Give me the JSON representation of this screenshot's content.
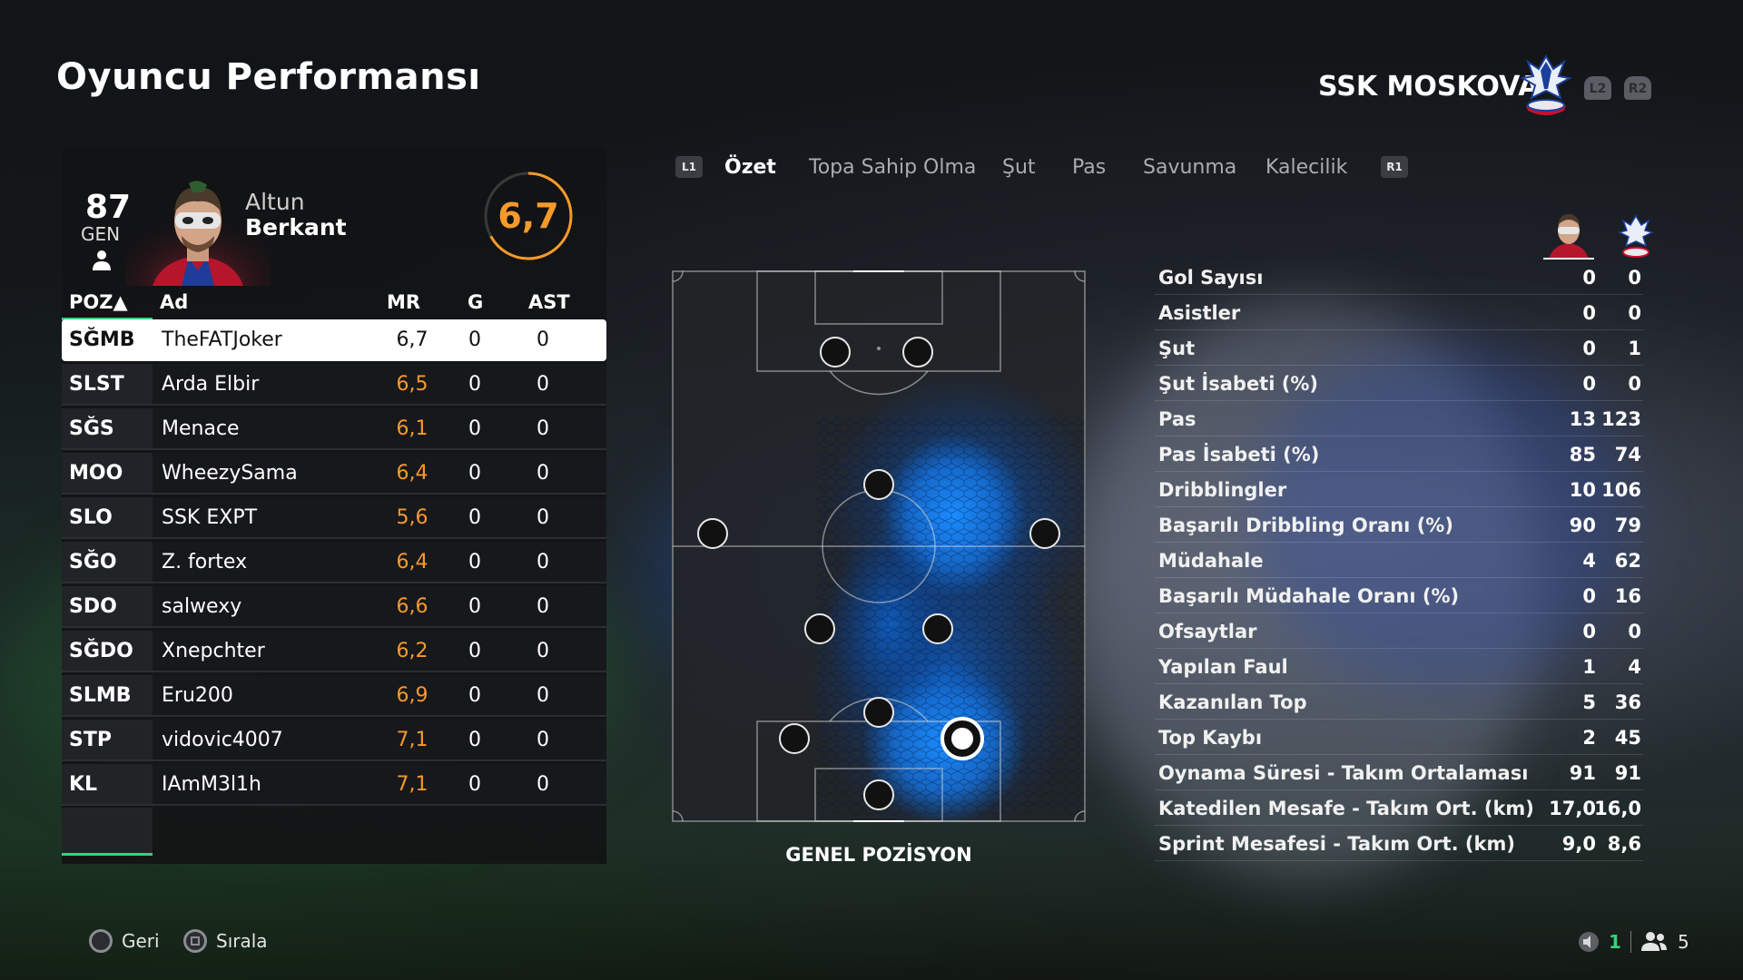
{
  "header": {
    "title": "Oyuncu Performansı",
    "team_name": "SSK MOSKOVA",
    "trigger_left": "L2",
    "trigger_right": "R2"
  },
  "player": {
    "gen_value": "87",
    "gen_label": "GEN",
    "first_name": "Altun",
    "last_name": "Berkant",
    "rating": "6,7"
  },
  "table": {
    "headers": {
      "poz": "POZ▲",
      "ad": "Ad",
      "mr": "MR",
      "g": "G",
      "ast": "AST"
    },
    "rows": [
      {
        "pos": "SĞMB",
        "name": "TheFATJoker",
        "mr": "6,7",
        "g": "0",
        "ast": "0"
      },
      {
        "pos": "SLST",
        "name": "Arda Elbir",
        "mr": "6,5",
        "g": "0",
        "ast": "0"
      },
      {
        "pos": "SĞS",
        "name": "Menace",
        "mr": "6,1",
        "g": "0",
        "ast": "0"
      },
      {
        "pos": "MOO",
        "name": "WheezySama",
        "mr": "6,4",
        "g": "0",
        "ast": "0"
      },
      {
        "pos": "SLO",
        "name": "SSK EXPT",
        "mr": "5,6",
        "g": "0",
        "ast": "0"
      },
      {
        "pos": "SĞO",
        "name": "Z. fortex",
        "mr": "6,4",
        "g": "0",
        "ast": "0"
      },
      {
        "pos": "SDO",
        "name": "salwexy",
        "mr": "6,6",
        "g": "0",
        "ast": "0"
      },
      {
        "pos": "SĞDO",
        "name": "Xnepchter",
        "mr": "6,2",
        "g": "0",
        "ast": "0"
      },
      {
        "pos": "SLMB",
        "name": "Eru200",
        "mr": "6,9",
        "g": "0",
        "ast": "0"
      },
      {
        "pos": "STP",
        "name": "vidovic4007",
        "mr": "7,1",
        "g": "0",
        "ast": "0"
      },
      {
        "pos": "KL",
        "name": "IAmM3l1h",
        "mr": "7,1",
        "g": "0",
        "ast": "0"
      }
    ]
  },
  "tabs": {
    "left_badge": "L1",
    "right_badge": "R1",
    "items": [
      "Özet",
      "Topa Sahip Olma",
      "Şut",
      "Pas",
      "Savunma",
      "Kalecilik"
    ],
    "active": "Özet"
  },
  "pitch": {
    "caption": "GENEL POZİSYON"
  },
  "stats": [
    {
      "label": "Gol Sayısı",
      "player": "0",
      "team": "0"
    },
    {
      "label": "Asistler",
      "player": "0",
      "team": "0"
    },
    {
      "label": "Şut",
      "player": "0",
      "team": "1"
    },
    {
      "label": "Şut İsabeti (%)",
      "player": "0",
      "team": "0"
    },
    {
      "label": "Pas",
      "player": "13",
      "team": "123"
    },
    {
      "label": "Pas İsabeti (%)",
      "player": "85",
      "team": "74"
    },
    {
      "label": "Dribblingler",
      "player": "10",
      "team": "106"
    },
    {
      "label": "Başarılı Dribbling Oranı (%)",
      "player": "90",
      "team": "79"
    },
    {
      "label": "Müdahale",
      "player": "4",
      "team": "62"
    },
    {
      "label": "Başarılı Müdahale Oranı (%)",
      "player": "0",
      "team": "16"
    },
    {
      "label": "Ofsaytlar",
      "player": "0",
      "team": "0"
    },
    {
      "label": "Yapılan Faul",
      "player": "1",
      "team": "4"
    },
    {
      "label": "Kazanılan Top",
      "player": "5",
      "team": "36"
    },
    {
      "label": "Top Kaybı",
      "player": "2",
      "team": "45"
    },
    {
      "label": "Oynama Süresi - Takım Ortalaması",
      "player": "91",
      "team": "91"
    },
    {
      "label": "Katedilen Mesafe - Takım Ort. (km)",
      "player": "17,0",
      "team": "16,0"
    },
    {
      "label": "Sprint Mesafesi - Takım Ort. (km)",
      "player": "9,0",
      "team": "8,6"
    }
  ],
  "footer": {
    "back_label": "Geri",
    "sort_label": "Sırala",
    "voice_count": "1",
    "party_count": "5"
  },
  "colors": {
    "accent_orange": "#f59a2b",
    "accent_green": "#35d27a",
    "heat_blue": "#1a8cff"
  }
}
